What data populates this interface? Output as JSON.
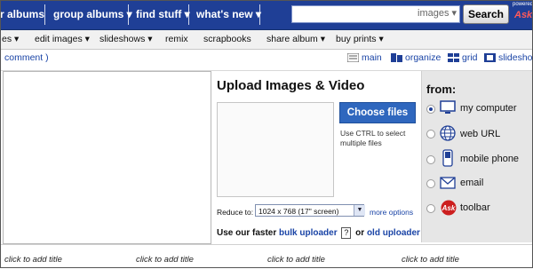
{
  "nav": {
    "items": [
      {
        "label": "r albums"
      },
      {
        "label": "group albums ▾"
      },
      {
        "label": "find stuff ▾"
      },
      {
        "label": "what's new ▾"
      }
    ]
  },
  "search": {
    "value": "",
    "scope": "images ▾",
    "button": "Search",
    "powered_label": "powered",
    "brand": "Ask"
  },
  "toolbar": {
    "items": [
      {
        "label": "es ▾"
      },
      {
        "label": "edit images ▾"
      },
      {
        "label": "slideshows ▾"
      },
      {
        "label": "remix"
      },
      {
        "label": "scrapbooks"
      },
      {
        "label": "share album ▾"
      },
      {
        "label": "buy prints ▾"
      }
    ]
  },
  "viewbar": {
    "comment": "comment )",
    "views": [
      {
        "label": "main",
        "icon": "main-view-icon"
      },
      {
        "label": "organize",
        "icon": "organize-icon"
      },
      {
        "label": "grid",
        "icon": "grid-icon"
      },
      {
        "label": "slidesho",
        "icon": "slideshow-icon"
      }
    ]
  },
  "upload": {
    "title": "Upload Images & Video",
    "choose_button": "Choose files",
    "ctrl_hint": "Use CTRL to select multiple files",
    "reduce_label": "Reduce to:",
    "reduce_value": "1024 x 768 (17\" screen)",
    "more_options": "more options",
    "faster_prefix": "Use our faster",
    "bulk_uploader": "bulk uploader",
    "help_mark": "?",
    "or": "or",
    "old_uploader": "old uploader"
  },
  "from": {
    "title": "from:",
    "sources": [
      {
        "label": "my computer",
        "icon": "computer-icon",
        "selected": true
      },
      {
        "label": "web URL",
        "icon": "globe-icon",
        "selected": false
      },
      {
        "label": "mobile phone",
        "icon": "mobile-phone-icon",
        "selected": false
      },
      {
        "label": "email",
        "icon": "envelope-icon",
        "selected": false
      },
      {
        "label": "toolbar",
        "icon": "ask-toolbar-icon",
        "selected": false
      }
    ]
  },
  "footer": {
    "add_title": [
      "click to add title",
      "click to add title",
      "click to add title",
      "click to add title"
    ]
  },
  "colors": {
    "nav_bg": "#1f3f96",
    "link": "#1a44a6",
    "button_blue": "#2f67be",
    "ask_red": "#cc1f1f"
  }
}
